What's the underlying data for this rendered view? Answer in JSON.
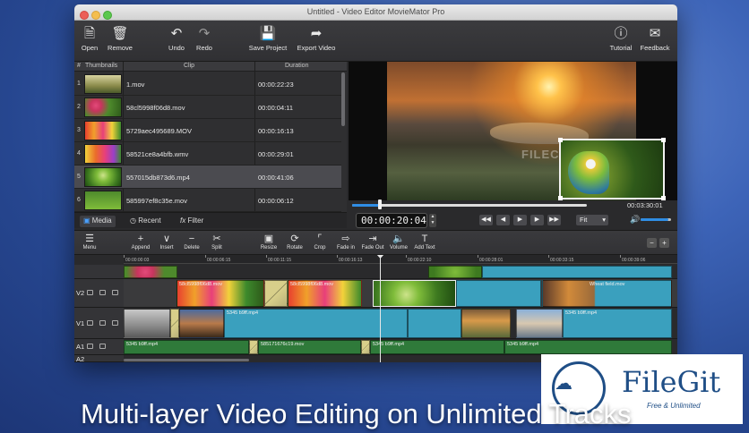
{
  "window": {
    "title": "Untitled - Video Editor MovieMator Pro"
  },
  "toolbar": {
    "open": "Open",
    "remove": "Remove",
    "undo": "Undo",
    "redo": "Redo",
    "save_project": "Save Project",
    "export_video": "Export Video",
    "tutorial": "Tutorial",
    "feedback": "Feedback"
  },
  "clip_list": {
    "headers": {
      "num": "#",
      "thumbnails": "Thumbnails",
      "clip": "Clip",
      "duration": "Duration"
    },
    "rows": [
      {
        "num": "1",
        "clip": "1.mov",
        "duration": "00:00:22:23"
      },
      {
        "num": "2",
        "clip": "58cl5998f06d8.mov",
        "duration": "00:00:04:11"
      },
      {
        "num": "3",
        "clip": "5729aec495689.MOV",
        "duration": "00:00:16:13"
      },
      {
        "num": "4",
        "clip": "58521ce8a4bfb.wmv",
        "duration": "00:00:29:01"
      },
      {
        "num": "5",
        "clip": "557015db873d6.mp4",
        "duration": "00:00:41:06"
      },
      {
        "num": "6",
        "clip": "585997ef8c35e.mov",
        "duration": "00:00:06:12"
      }
    ],
    "tabs": {
      "media": "Media",
      "recent": "Recent",
      "filter": "Filter"
    }
  },
  "preview": {
    "current_time": "00:00:20:04",
    "total_time": "00:03:30:01",
    "progress": 0.12,
    "fit": "Fit",
    "volume": 0.9,
    "watermark": "FILEC"
  },
  "edit_toolbar": {
    "menu": "Menu",
    "append": "Append",
    "insert": "Insert",
    "delete": "Delete",
    "split": "Split",
    "resize": "Resize",
    "rotate": "Rotate",
    "crop": "Crop",
    "fade_in": "Fade in",
    "fade_out": "Fade Out",
    "volume": "Volume",
    "add_text": "Add Text"
  },
  "timeline": {
    "ruler": [
      "00:00:00:03",
      "00:00:06:15",
      "00:00:11:15",
      "00:00:16:13",
      "00:00:22:10",
      "00:00:28:01",
      "00:00:33:15",
      "00:00:39:06"
    ],
    "tracks": {
      "v2": "V2",
      "v1": "V1",
      "a1": "A1",
      "a2": "A2"
    },
    "v2_clips": {
      "c1": "58cl5998f06d8.mov",
      "c2": "58cl5998f06d8.mov",
      "c3": "Wheat field.mov"
    },
    "v1_clips": {
      "c1": "5345 b9ff.mp4",
      "c2": "5345 b9ff.mp4"
    },
    "a1_clips": {
      "c1": "5345 b9ff.mp4",
      "c2": "585171676c19.mov",
      "c3": "5345 b9ff.mp4",
      "c4": "5345 b9ff.mp4"
    }
  },
  "branding": {
    "name": "FileGit",
    "tagline": "Free & Unlimited"
  },
  "caption": "Multi-layer Video Editing on Unlimited Tracks"
}
